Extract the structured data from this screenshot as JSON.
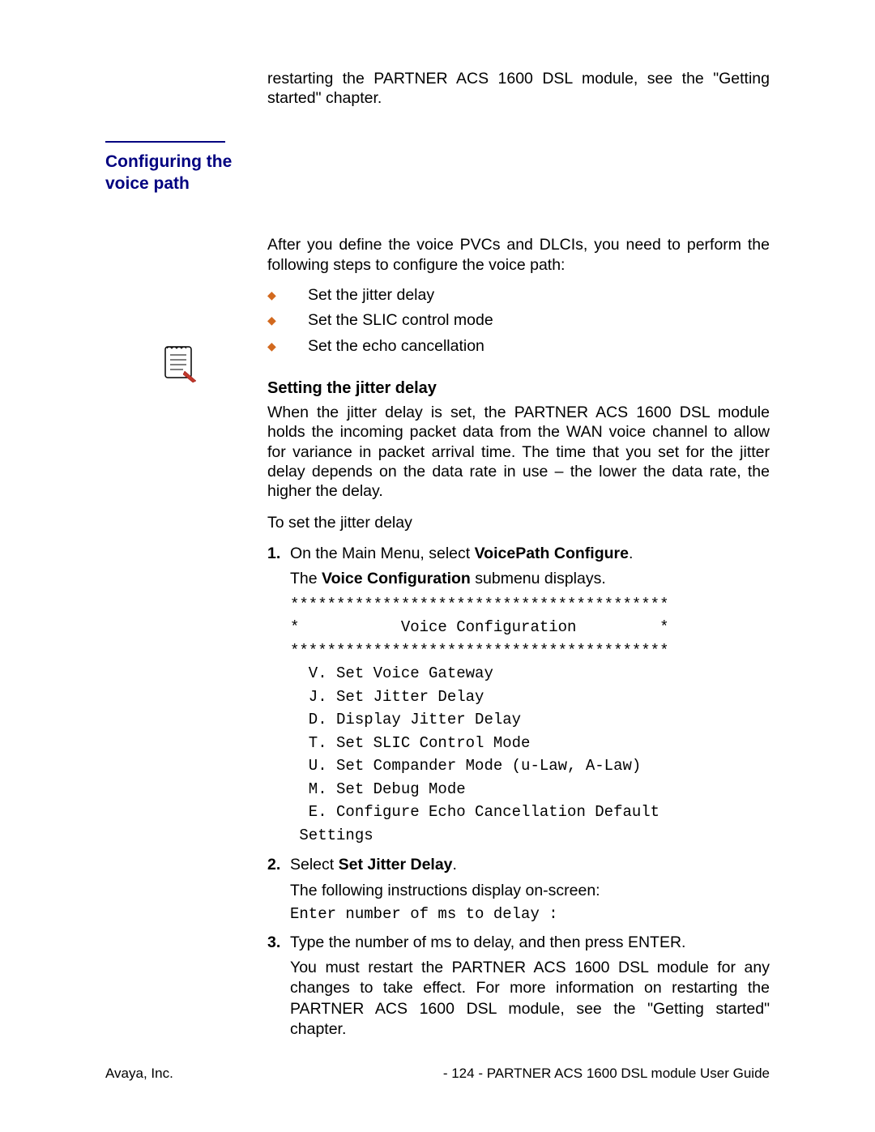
{
  "top_continued": "restarting the PARTNER ACS 1600 DSL module, see the \"Getting started\" chapter.",
  "section_heading": "Configuring the voice path",
  "intro": "After you define the voice PVCs and DLCIs, you need to perform the following steps to configure the voice path:",
  "bullets": [
    "Set the jitter delay",
    "Set the SLIC control mode",
    "Set the echo cancellation"
  ],
  "subheading": "Setting the jitter delay",
  "jitter_para": "When the jitter delay is set, the PARTNER ACS 1600 DSL module holds the incoming packet data from the WAN voice channel to allow for variance in packet arrival time.  The time that you set for the jitter delay depends on the data rate in use – the lower the data rate, the higher the delay.",
  "to_set": "To set the jitter delay",
  "step1_pre": "On the Main Menu, select ",
  "step1_bold": "VoicePath Configure",
  "step1_post": ".",
  "step1_sub_pre": "The ",
  "step1_sub_bold": "Voice Configuration",
  "step1_sub_post": " submenu displays.",
  "menu": "*****************************************\n*           Voice Configuration         *\n*****************************************\n  V. Set Voice Gateway\n  J. Set Jitter Delay\n  D. Display Jitter Delay\n  T. Set SLIC Control Mode\n  U. Set Compander Mode (u-Law, A-Law)\n  M. Set Debug Mode\n  E. Configure Echo Cancellation Default\n Settings",
  "step2_pre": "Select ",
  "step2_bold": "Set Jitter Delay",
  "step2_post": ".",
  "step2_sub": "The following instructions display on-screen:",
  "prompt": "Enter number of ms to delay :",
  "step3_line": "Type the number of ms to delay, and then press ENTER.",
  "step3_sub": "You must restart the PARTNER ACS 1600 DSL module for any changes to take effect.  For more information on restarting the PARTNER ACS 1600 DSL module, see the \"Getting started\" chapter.",
  "footer_left": "Avaya, Inc.",
  "footer_right": "- 124 - PARTNER ACS 1600 DSL module User Guide",
  "nums": {
    "n1": "1.",
    "n2": "2.",
    "n3": "3."
  }
}
